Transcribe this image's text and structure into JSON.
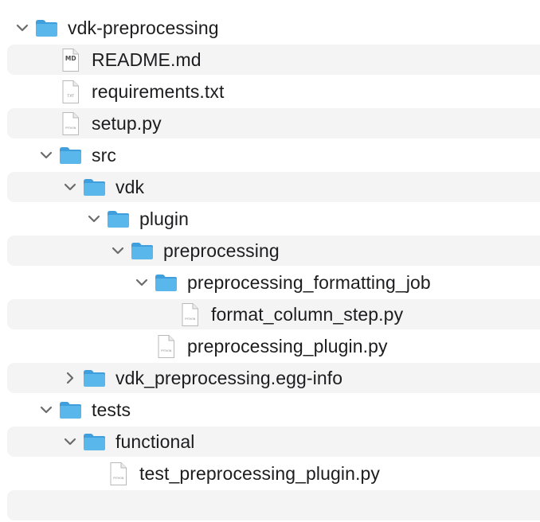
{
  "tree": {
    "rows": [
      {
        "label": "vdk-preprocessing",
        "kind": "folder",
        "state": "expanded",
        "depth": 0,
        "icon": "folder-icon"
      },
      {
        "label": "README.md",
        "kind": "file",
        "state": "",
        "depth": 1,
        "icon": "markdown-file-icon",
        "badge": "MD"
      },
      {
        "label": "requirements.txt",
        "kind": "file",
        "state": "",
        "depth": 1,
        "icon": "text-file-icon",
        "badge": "TXT"
      },
      {
        "label": "setup.py",
        "kind": "file",
        "state": "",
        "depth": 1,
        "icon": "python-file-icon",
        "badge": "PYTHON"
      },
      {
        "label": "src",
        "kind": "folder",
        "state": "expanded",
        "depth": 1,
        "icon": "folder-icon"
      },
      {
        "label": "vdk",
        "kind": "folder",
        "state": "expanded",
        "depth": 2,
        "icon": "folder-icon"
      },
      {
        "label": "plugin",
        "kind": "folder",
        "state": "expanded",
        "depth": 3,
        "icon": "folder-icon"
      },
      {
        "label": "preprocessing",
        "kind": "folder",
        "state": "expanded",
        "depth": 4,
        "icon": "folder-icon"
      },
      {
        "label": "preprocessing_formatting_job",
        "kind": "folder",
        "state": "expanded",
        "depth": 5,
        "icon": "folder-icon"
      },
      {
        "label": "format_column_step.py",
        "kind": "file",
        "state": "",
        "depth": 6,
        "icon": "python-file-icon",
        "badge": "PYTHON"
      },
      {
        "label": "preprocessing_plugin.py",
        "kind": "file",
        "state": "",
        "depth": 5,
        "icon": "python-file-icon",
        "badge": "PYTHON"
      },
      {
        "label": "vdk_preprocessing.egg-info",
        "kind": "folder",
        "state": "collapsed",
        "depth": 2,
        "icon": "folder-icon"
      },
      {
        "label": "tests",
        "kind": "folder",
        "state": "expanded",
        "depth": 1,
        "icon": "folder-icon"
      },
      {
        "label": "functional",
        "kind": "folder",
        "state": "expanded",
        "depth": 2,
        "icon": "folder-icon"
      },
      {
        "label": "test_preprocessing_plugin.py",
        "kind": "file",
        "state": "",
        "depth": 3,
        "icon": "python-file-icon",
        "badge": "PYTHON"
      },
      {
        "label": "",
        "kind": "empty",
        "state": "",
        "depth": 0,
        "icon": ""
      }
    ]
  },
  "colors": {
    "folder_front": "#5ab7ec",
    "folder_back": "#3e9fdc",
    "stripe": "#f4f4f5",
    "text": "#1d1d1f",
    "chevron": "#6b6b6b"
  }
}
